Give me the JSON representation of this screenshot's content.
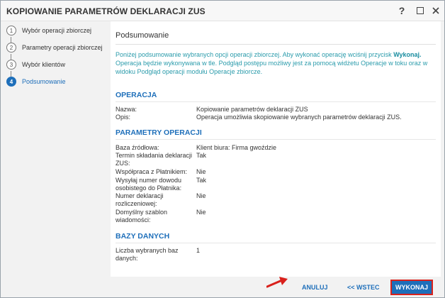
{
  "window": {
    "title": "KOPIOWANIE PARAMETRÓW DEKLARACJI ZUS",
    "help_label": "?"
  },
  "steps": [
    {
      "num": "1",
      "label": "Wybór operacji zbiorczej"
    },
    {
      "num": "2",
      "label": "Parametry operacji zbiorczej"
    },
    {
      "num": "3",
      "label": "Wybór klientów"
    },
    {
      "num": "4",
      "label": "Podsumowanie"
    }
  ],
  "summary": {
    "title": "Podsumowanie",
    "info_before": "Poniżej podsumowanie wybranych opcji operacji zbiorczej. Aby wykonać operację wciśnij przycisk ",
    "info_bold": "Wykonaj.",
    "info_after": " Operacja będzie wykonywana w tle. Podgląd postępu możliwy jest za pomocą widżetu Operacje w toku oraz w widoku Podgląd operacji modułu Operacje zbiorcze."
  },
  "sections": {
    "operacja": {
      "heading": "OPERACJA",
      "rows": [
        {
          "label": "Nazwa:",
          "value": "Kopiowanie parametrów deklaracji ZUS"
        },
        {
          "label": "Opis:",
          "value": "Operacja umożliwia skopiowanie wybranych parametrów deklaracji ZUS."
        }
      ]
    },
    "parametry": {
      "heading": "PARAMETRY OPERACJI",
      "rows": [
        {
          "label": "Baza źródłowa:",
          "value": "Klient biura: Firma gwoździe"
        },
        {
          "label": "Termin składania deklaracji ZUS:",
          "value": "Tak"
        },
        {
          "label": "Współpraca z Płatnikiem:",
          "value": "Nie"
        },
        {
          "label": "Wysyłaj numer dowodu osobistego do Płatnika:",
          "value": "Tak"
        },
        {
          "label": "Numer deklaracji rozliczeniowej:",
          "value": "Nie"
        },
        {
          "label": "Domyślny szablon wiadomości:",
          "value": "Nie"
        }
      ]
    },
    "bazy": {
      "heading": "BAZY DANYCH",
      "rows": [
        {
          "label": "Liczba wybranych baz danych:",
          "value": "1"
        }
      ]
    }
  },
  "footer": {
    "cancel_label": "ANULUJ",
    "back_label": "<< WSTEC",
    "execute_label": "WYKONAJ"
  },
  "colors": {
    "accent": "#1e6fba",
    "info_text": "#2a9bab",
    "highlight_border": "#d9211c"
  }
}
